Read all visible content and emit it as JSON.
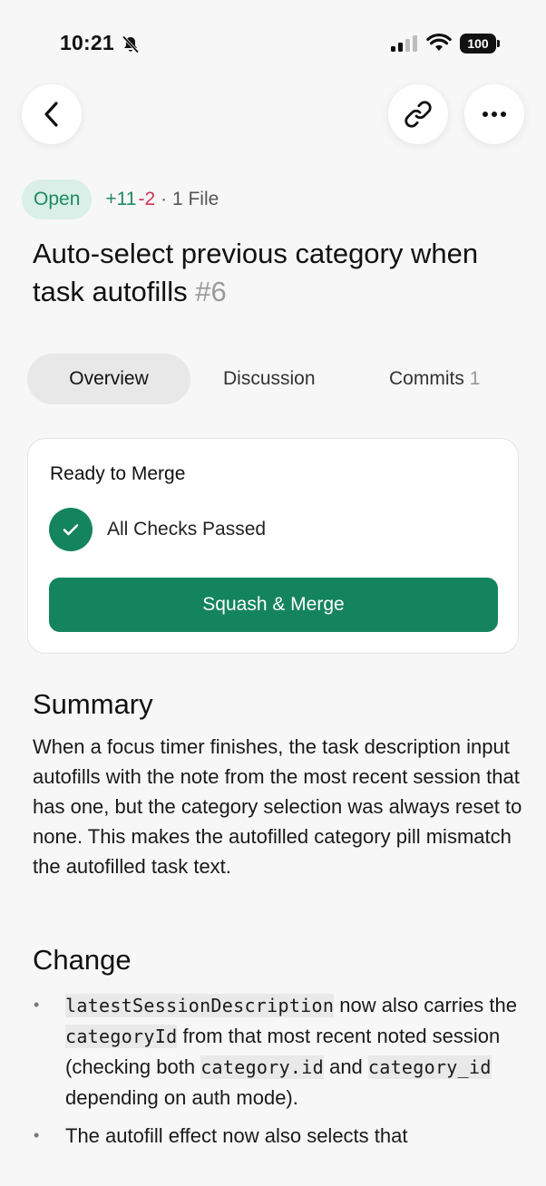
{
  "status_bar": {
    "time": "10:21",
    "battery": "100",
    "icons": [
      "bell-slash-icon",
      "signal-icon",
      "wifi-icon",
      "battery-icon"
    ]
  },
  "nav": {
    "icons": [
      "chevron-left-icon",
      "link-icon",
      "ellipsis-icon"
    ]
  },
  "pr": {
    "status": "Open",
    "additions": "+11",
    "deletions": "-2",
    "files": "· 1 File",
    "title": "Auto-select previous category when task autofills",
    "number": "#6"
  },
  "tabs": {
    "overview": "Overview",
    "discussion": "Discussion",
    "commits": "Commits",
    "commit_count": "1"
  },
  "merge_card": {
    "title": "Ready to Merge",
    "check_label": "All Checks Passed",
    "button_label": "Squash & Merge"
  },
  "summary": {
    "heading": "Summary",
    "text": "When a focus timer finishes, the task description input autofills with the note from the most recent session that has one, but the category selection was always reset to none. This makes the autofilled category pill mismatch the autofilled task text."
  },
  "change": {
    "heading": "Change",
    "bullet1": {
      "code1": "latestSessionDescription",
      "text1": " now also carries the ",
      "code2": "categoryId",
      "text2": " from that most recent noted session (checking both ",
      "code3": "category.id",
      "text3": " and ",
      "code4": "category_id",
      "text4": " depending on auth mode)."
    },
    "bullet2": "The autofill effect now also selects that"
  },
  "colors": {
    "accent_green": "#14845f",
    "open_pill_bg": "#d9efe7",
    "deletion_red": "#d13352",
    "background": "#f7f7f7"
  }
}
